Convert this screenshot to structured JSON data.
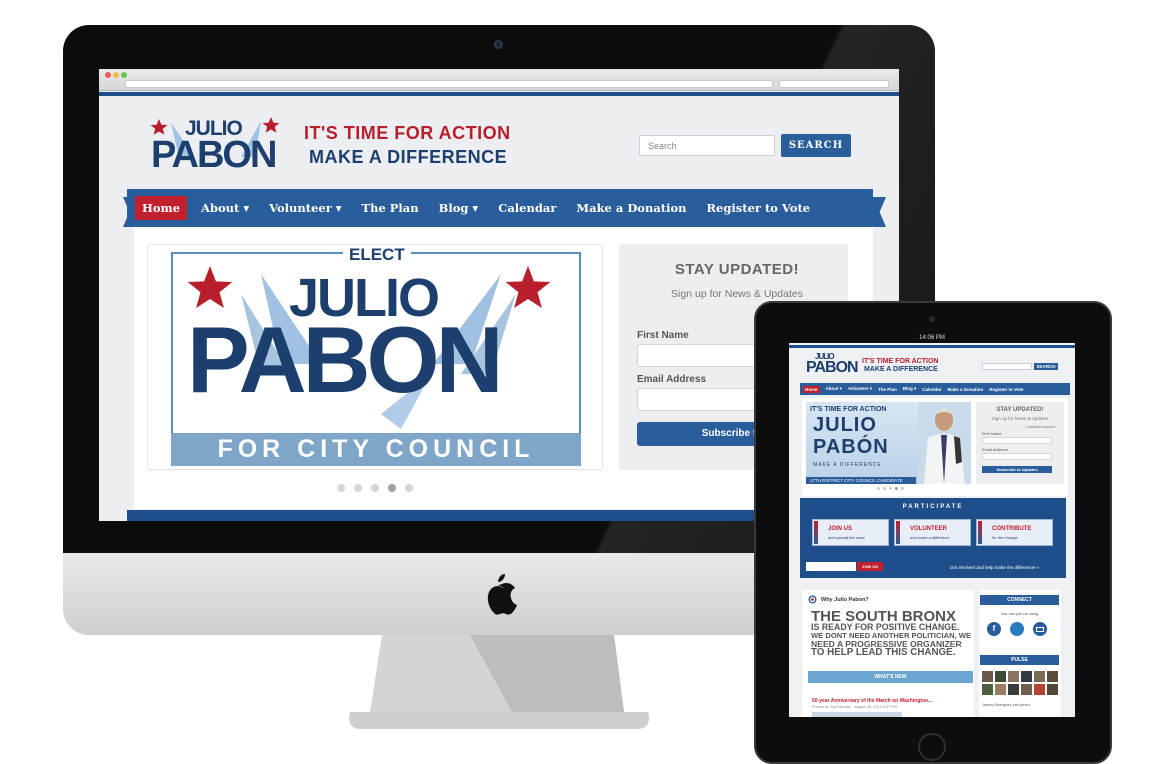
{
  "browser": {
    "traffic_lights": [
      "#ee5d56",
      "#f5bd4f",
      "#61c454"
    ]
  },
  "site": {
    "logo": {
      "first": "JULIO",
      "last": "PABON"
    },
    "tagline": [
      "IT'S TIME FOR ACTION",
      "MAKE A DIFFERENCE"
    ],
    "search": {
      "placeholder": "Search",
      "button": "SEARCH"
    },
    "nav": [
      {
        "label": "Home",
        "active": true
      },
      {
        "label": "About ▾"
      },
      {
        "label": "Volunteer ▾"
      },
      {
        "label": "The Plan"
      },
      {
        "label": "Blog ▾"
      },
      {
        "label": "Calendar"
      },
      {
        "label": "Make a Donation"
      },
      {
        "label": "Register to Vote"
      }
    ],
    "slider": {
      "elect": "ELECT",
      "first": "JULIO",
      "last": "PABON",
      "office": "FOR CITY COUNCIL",
      "pages": 5,
      "active_page": 4
    },
    "signup": {
      "title": "STAY UPDATED!",
      "subtitle": "Sign up for News & Updates",
      "first_name_label": "First Name",
      "email_label": "Email Address",
      "button": "Subscribe to U"
    }
  },
  "ipad": {
    "status_time": "14:06 PM",
    "logo": {
      "first": "JULIO",
      "last": "PABON"
    },
    "tagline": [
      "IT'S TIME FOR ACTION",
      "MAKE A DIFFERENCE"
    ],
    "search_button": "SEARCH",
    "nav": [
      "Home",
      "About ▾",
      "Volunteer ▾",
      "The Plan",
      "Blog ▾",
      "Calendar",
      "Make a Donation",
      "Register to Vote"
    ],
    "hero": {
      "tagline": "IT'S TIME FOR ACTION",
      "first": "JULIO",
      "last": "PABÓN",
      "sub1": "MAKE A DIFFERENCE",
      "sub2": "17TH DISTRICT CITY COUNCIL CANDIDATE"
    },
    "signup": {
      "title": "STAY UPDATED!",
      "subtitle": "Sign up for News & Updates",
      "required": "* indicates required",
      "first_name_label": "First Name",
      "email_label": "Email Address",
      "button": "Subscribe to Updates"
    },
    "participate": {
      "title": "PARTICIPATE",
      "cards": [
        {
          "title": "JOIN US",
          "sub": "and spread the word"
        },
        {
          "title": "VOLUNTEER",
          "sub": "and make a difference"
        },
        {
          "title": "CONTRIBUTE",
          "sub": "for the change"
        }
      ],
      "join_button": "JOIN US",
      "cta": "Get involved and help make the difference! »"
    },
    "why": {
      "heading": "Why Julio Pabon?",
      "lines": [
        "THE SOUTH BRONX",
        "IS READY FOR POSITIVE CHANGE.",
        "WE DONT NEED ANOTHER POLITICIAN, WE",
        "NEED A PROGRESSIVE ORGANIZER",
        "TO HELP LEAD THIS CHANGE."
      ]
    },
    "whats_new": "WHAT'S NEW",
    "post": {
      "title": "50-year Anniversary of the March on Washington...",
      "meta": "Posted by Saj Rahman · August 28, 2013 5:57 PM"
    },
    "connect": {
      "title": "CONNECT",
      "sub": "You can join us using"
    },
    "pulse": {
      "title": "PULSE",
      "caption": "James Rodriguez just joined."
    }
  }
}
